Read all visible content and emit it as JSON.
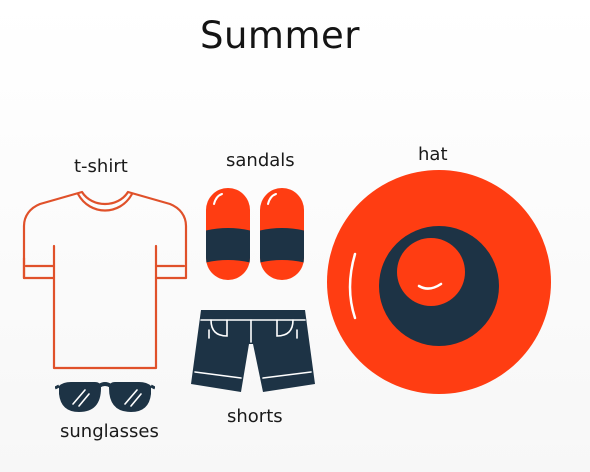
{
  "title": "Summer",
  "items": {
    "tshirt": {
      "label": "t-shirt"
    },
    "sandals": {
      "label": "sandals"
    },
    "hat": {
      "label": "hat"
    },
    "shorts": {
      "label": "shorts"
    },
    "sunglasses": {
      "label": "sunglasses"
    }
  },
  "colors": {
    "accent": "#ff3d12",
    "tshirt_outline": "#e0512a",
    "navy": "#1d3345",
    "text": "#141414"
  }
}
